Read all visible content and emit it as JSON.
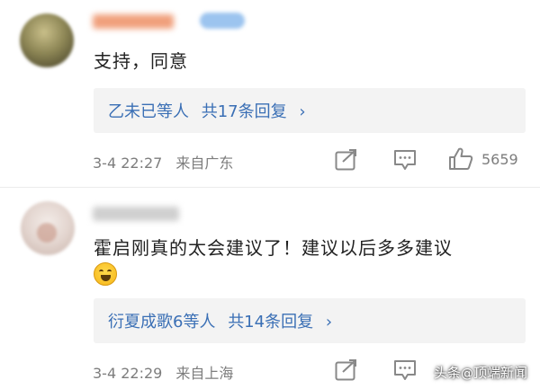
{
  "comments": [
    {
      "text": "支持，同意",
      "replies_names": "乙未已等人",
      "replies_count": "共17条回复",
      "reply_arrow": "›",
      "date": "3-4 22:27",
      "source": "来自广东",
      "likes": "5659"
    },
    {
      "text": "霍启刚真的太会建议了！建议以后多多建议",
      "replies_names": "衍夏成歌6等人",
      "replies_count": "共14条回复",
      "reply_arrow": "›",
      "date": "3-4 22:29",
      "source": "来自上海",
      "likes": ""
    }
  ],
  "icons": {
    "share": "share-icon",
    "comment": "comment-icon",
    "like": "thumbs-up-icon"
  },
  "watermark": {
    "prefix": "头条",
    "at": "@",
    "account": "顶端新闻"
  },
  "colors": {
    "link": "#3a6fb5",
    "meta": "#7d7d7d",
    "reply_bg": "#f3f3f3"
  }
}
